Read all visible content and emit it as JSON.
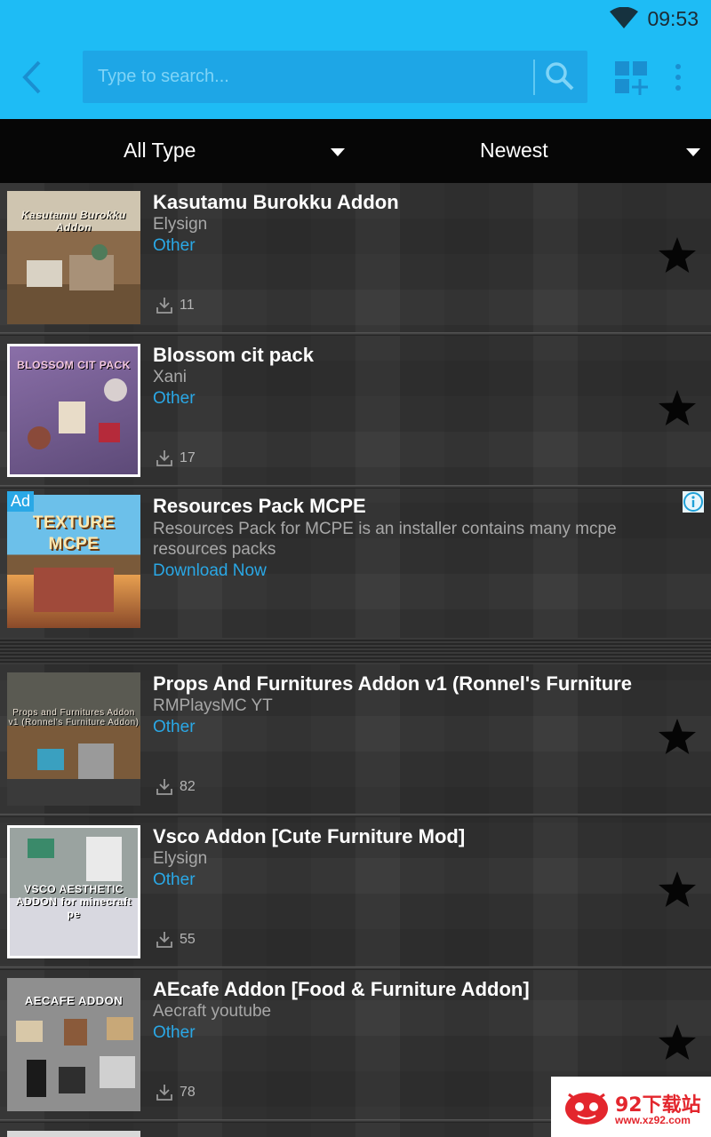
{
  "status_bar": {
    "time": "09:53",
    "icons": [
      "wifi-icon"
    ]
  },
  "app_bar": {
    "search_placeholder": "Type to search...",
    "icons": [
      "back-arrow-icon",
      "search-icon",
      "grid-add-icon",
      "more-vert-icon"
    ],
    "accent_color": "#1ebcf5"
  },
  "filters": {
    "type": "All Type",
    "sort": "Newest"
  },
  "items": [
    {
      "title": "Kasutamu Burokku Addon",
      "author": "Elysign",
      "category": "Other",
      "downloads": "11",
      "thumb_text": "Kasutamu Burokku Addon"
    },
    {
      "title": "Blossom cit pack",
      "author": "Xani",
      "category": "Other",
      "downloads": "17",
      "thumb_text": "BLOSSOM CIT PACK"
    },
    {
      "title": "Props And Furnitures Addon v1 (Ronnel's Furniture",
      "author": "RMPlaysMC YT",
      "category": "Other",
      "downloads": "82",
      "thumb_text": "Props and Furnitures Addon v1 (Ronnel's Furniture Addon)"
    },
    {
      "title": "Vsco Addon [Cute Furniture Mod]",
      "author": "Elysign",
      "category": "Other",
      "downloads": "55",
      "thumb_text": "VSCO AESTHETIC ADDON for minecraft pe"
    },
    {
      "title": "AEcafe Addon [Food & Furniture Addon]",
      "author": "Aecraft youtube",
      "category": "Other",
      "downloads": "78",
      "thumb_text": "AECAFE ADDON"
    }
  ],
  "ad": {
    "tag": "Ad",
    "title": "Resources Pack MCPE",
    "description": "Resources Pack for MCPE is an installer contains many mcpe resources packs",
    "cta": "Download Now",
    "thumb_text": "TEXTURE MCPE"
  },
  "watermark": {
    "text": "92下载站",
    "url": "www.xz92.com"
  }
}
